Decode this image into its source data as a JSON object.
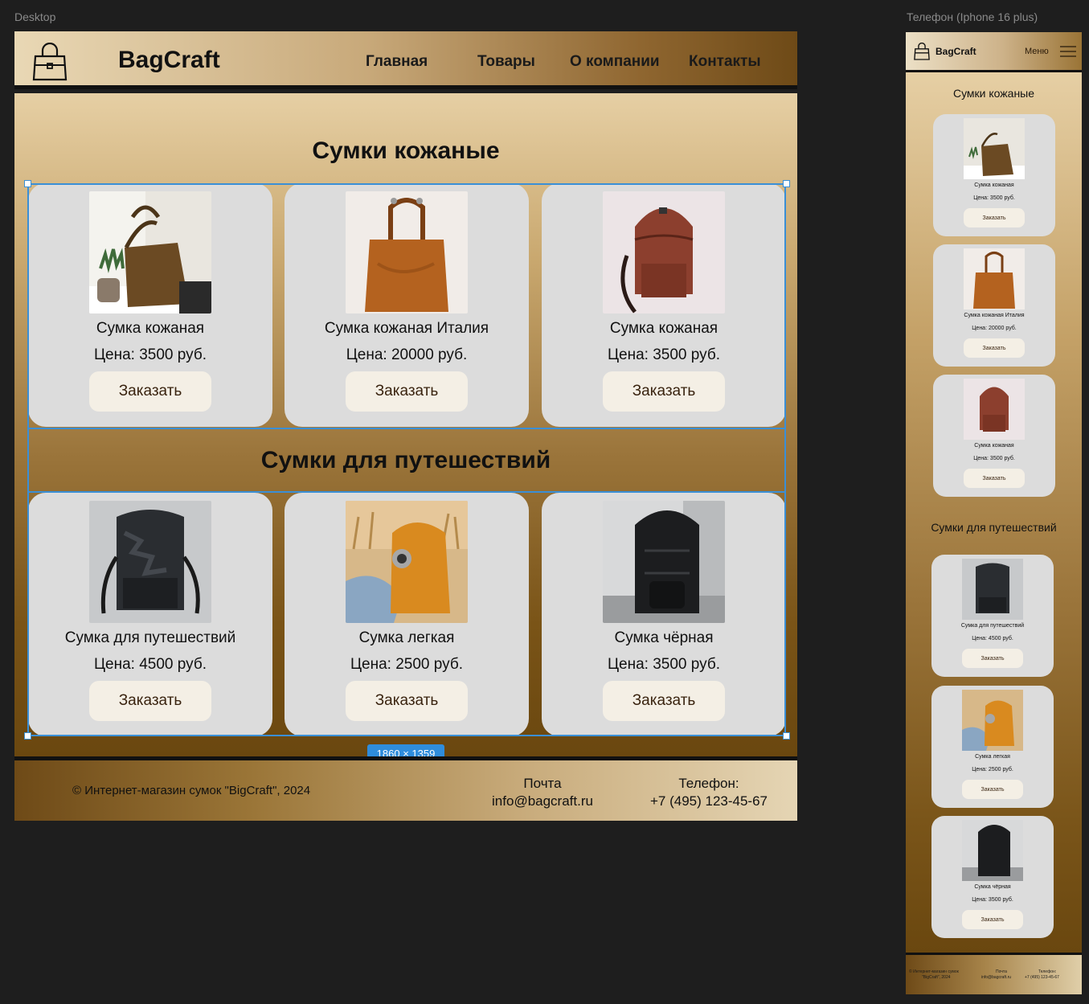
{
  "frames": {
    "desktop_label": "Desktop",
    "phone_label": "Телефон (Iphone 16 plus)"
  },
  "desktop": {
    "brand": "BagCraft",
    "nav": [
      "Главная",
      "Товары",
      "О компании",
      "Контакты"
    ],
    "sections": [
      {
        "title": "Сумки кожаные",
        "products": [
          {
            "name": "Сумка кожаная",
            "price": "Цена: 3500 руб.",
            "button": "Заказать",
            "photo": "brown-tote-photo"
          },
          {
            "name": "Сумка кожаная Италия",
            "price": "Цена: 20000 руб.",
            "button": "Заказать",
            "photo": "tan-tote-photo"
          },
          {
            "name": "Сумка кожаная",
            "price": "Цена: 3500 руб.",
            "button": "Заказать",
            "photo": "red-backpack-photo"
          }
        ]
      },
      {
        "title": "Сумки для путешествий",
        "products": [
          {
            "name": "Сумка для путешествий",
            "price": "Цена: 4500 руб.",
            "button": "Заказать",
            "photo": "black-camo-backpack-photo"
          },
          {
            "name": "Сумка легкая",
            "price": "Цена: 2500 руб.",
            "button": "Заказать",
            "photo": "orange-backpack-photo"
          },
          {
            "name": "Сумка чёрная",
            "price": "Цена: 3500 руб.",
            "button": "Заказать",
            "photo": "black-backpack-photo"
          }
        ]
      }
    ],
    "selection_size": "1860 × 1359",
    "footer": {
      "copyright": "© Интернет-магазин сумок \"BigCraft\", 2024",
      "mail_label": "Почта",
      "mail_value": "info@bagcraft.ru",
      "phone_label": "Телефон:",
      "phone_value": "+7 (495) 123-45-67"
    }
  },
  "phone": {
    "brand": "BagCraft",
    "menu": "Меню",
    "sections": [
      {
        "title": "Сумки кожаные",
        "products": [
          {
            "name": "Сумка кожаная",
            "price": "Цена: 3500 руб.",
            "button": "Заказать"
          },
          {
            "name": "Сумка кожаная Италия",
            "price": "Цена: 20000 руб.",
            "button": "Заказать"
          },
          {
            "name": "Сумка кожаная",
            "price": "Цена: 3500 руб.",
            "button": "Заказать"
          }
        ]
      },
      {
        "title": "Сумки для путешествий",
        "products": [
          {
            "name": "Сумка для путешествий",
            "price": "Цена: 4500 руб.",
            "button": "Заказать"
          },
          {
            "name": "Сумка легкая",
            "price": "Цена: 2500 руб.",
            "button": "Заказать"
          },
          {
            "name": "Сумка чёрная",
            "price": "Цена: 3500 руб.",
            "button": "Заказать"
          }
        ]
      }
    ],
    "footer": {
      "copyright_1": "© Интернет-магазин сумок",
      "copyright_2": "\"BigCraft\", 2024",
      "mail_label": "Почта",
      "mail_value": "info@bagcraft.ru",
      "phone_label": "Телефон:",
      "phone_value": "+7 (495) 123-45-67"
    }
  },
  "colors": {
    "accent_brown": "#6e4a17",
    "card_bg": "#dcdcdc",
    "button_bg": "#f4efe5",
    "selection": "#3a8fd6"
  }
}
